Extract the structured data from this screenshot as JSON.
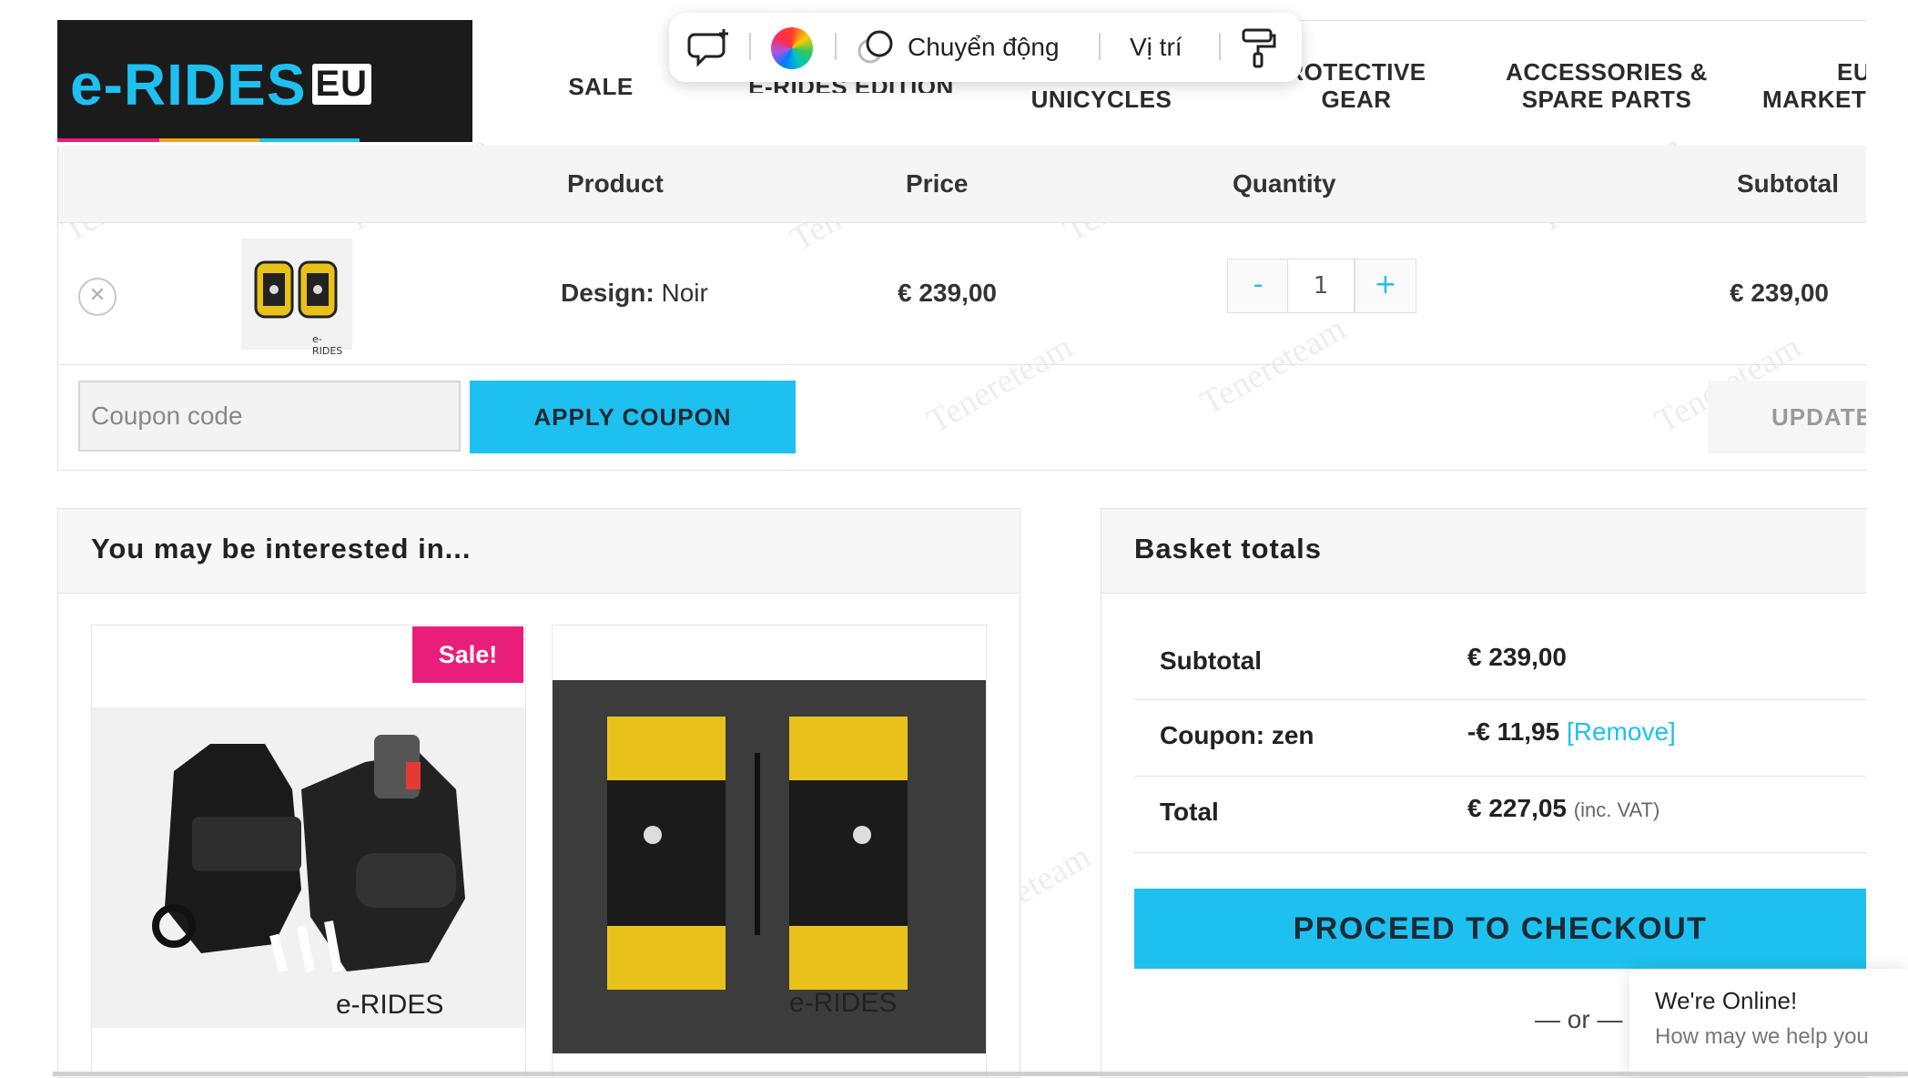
{
  "logo": {
    "brand": "e-RIDES",
    "region": "EU"
  },
  "nav": {
    "items": [
      "SALE",
      "E-RIDES EDITION",
      "UNICYCLES",
      "ROTECTIVE",
      "GEAR",
      "ACCESSORIES &",
      "SPARE PARTS",
      "EU",
      "MARKET"
    ]
  },
  "toolbar": {
    "motion_label": "Chuyển động",
    "position_label": "Vị trí"
  },
  "cart": {
    "headers": {
      "product": "Product",
      "price": "Price",
      "quantity": "Quantity",
      "subtotal": "Subtotal"
    },
    "item": {
      "design_label": "Design:",
      "design_value": "Noir",
      "price": "€ 239,00",
      "quantity": "1",
      "subtotal": "€ 239,00",
      "thumb_brand": "e-RIDES"
    },
    "qty_minus": "-",
    "qty_plus": "+",
    "coupon_placeholder": "Coupon code",
    "apply_coupon": "APPLY COUPON",
    "update": "UPDATE"
  },
  "interested": {
    "title": "You may be interested in...",
    "sale_badge": "Sale!",
    "card_brand": "e-RIDES"
  },
  "totals": {
    "title": "Basket totals",
    "subtotal_label": "Subtotal",
    "subtotal_value": "€ 239,00",
    "coupon_label": "Coupon: zen",
    "coupon_value": "-€ 11,95",
    "coupon_remove": "[Remove]",
    "total_label": "Total",
    "total_value": "€ 227,05",
    "total_note": "(inc. VAT)",
    "checkout": "PROCEED TO CHECKOUT",
    "or": "— or —"
  },
  "chat": {
    "title": "We're Online!",
    "subtitle": "How may we help you"
  },
  "watermark": "Tenereteam",
  "colors": {
    "accent": "#1ec0f0",
    "sale": "#e91e7a",
    "dark": "#1b1b1b"
  }
}
